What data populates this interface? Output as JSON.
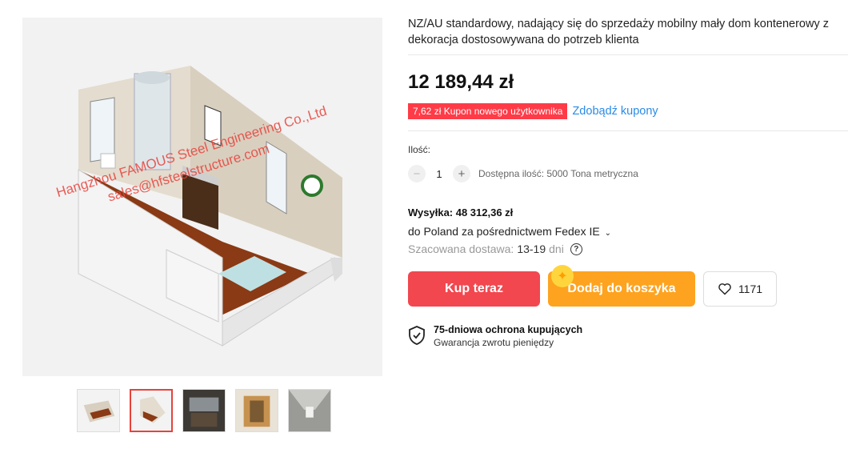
{
  "gallery": {
    "watermark_line1": "Hangzhou FAMOUS Steel Engineering Co.,Ltd",
    "watermark_line2": "sales@hfsteelstructure.com",
    "thumbnails": [
      "thumb-1",
      "thumb-2",
      "thumb-3",
      "thumb-4",
      "thumb-5"
    ],
    "active_index": 1
  },
  "product": {
    "title": "NZ/AU standardowy, nadający się do sprzedaży mobilny mały dom kontenerowy z dekoracja dostosowywana do potrzeb klienta",
    "price": "12 189,44 zł",
    "coupon_label": "7,62 zł Kupon nowego użytkownika",
    "coupon_link": "Zdobądź kupony"
  },
  "quantity": {
    "label": "Ilość:",
    "minus": "−",
    "value": "1",
    "plus": "+",
    "stock": "Dostępna ilość: 5000 Tona metryczna"
  },
  "shipping": {
    "title": "Wysyłka: 48 312,36 zł",
    "route": "do Poland za pośrednictwem Fedex IE",
    "chevron": "⌄",
    "estimate_label": "Szacowana dostawa:",
    "estimate_days": "13-19",
    "estimate_unit": "dni",
    "help": "?"
  },
  "actions": {
    "buy_now": "Kup teraz",
    "add_to_cart": "Dodaj do koszyka",
    "wishlist_count": "1171"
  },
  "protection": {
    "title": "75-dniowa ochrona kupujących",
    "subtitle": "Gwarancja zwrotu pieniędzy"
  },
  "colors": {
    "accent_red": "#f2474f",
    "accent_orange": "#fea31f",
    "link_blue": "#2a8be6",
    "coupon_red": "#ff3b47"
  }
}
